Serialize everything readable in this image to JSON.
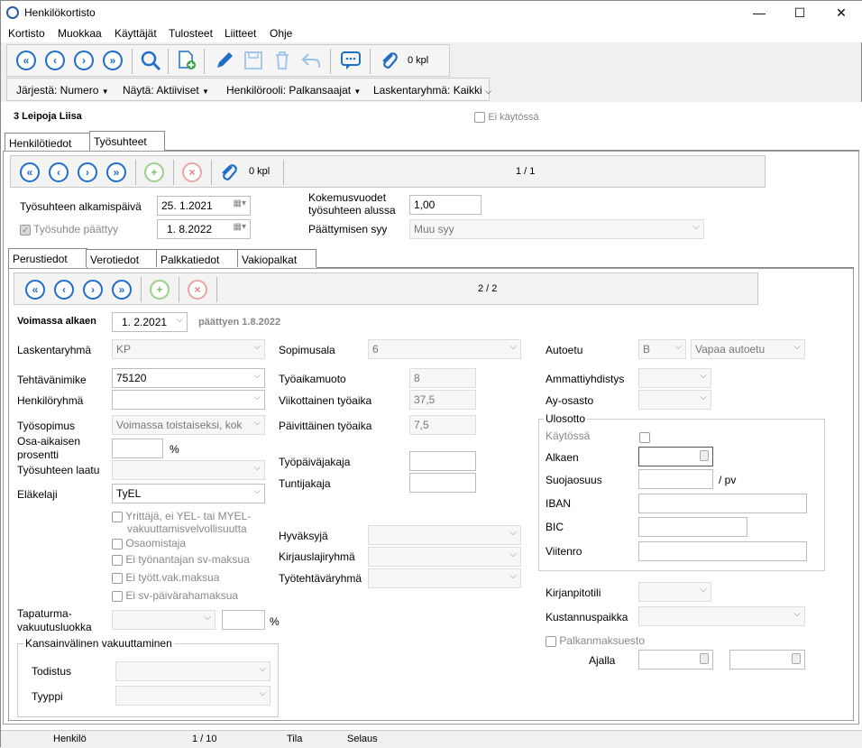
{
  "window": {
    "title": "Henkilökortisto",
    "minimize": "—",
    "maximize": "☐",
    "close": "✕"
  },
  "menu": [
    "Kortisto",
    "Muokkaa",
    "Käyttäjät",
    "Tulosteet",
    "Liitteet",
    "Ohje"
  ],
  "toolbar": {
    "attachments_count": "0 kpl"
  },
  "filters": {
    "sort": "Järjestä: Numero",
    "show": "Näytä: Aktiiviset",
    "role": "Henkilörooli: Palkansaajat",
    "group": "Laskentaryhmä: Kaikki"
  },
  "person": {
    "header": "3  Leipoja Liisa",
    "inactive_label": "Ei käytössä"
  },
  "outer_tabs": [
    "Henkilötiedot",
    "Työsuhteet"
  ],
  "employment_nav": {
    "attachments": "0 kpl",
    "page": "1 / 1"
  },
  "employment": {
    "start_label": "Työsuhteen alkamispäivä",
    "start_value": "25.  1.2021",
    "ended_label": "Työsuhde päättyy",
    "ended_value": "1.  8.2022",
    "experience_label_1": "Kokemusvuodet",
    "experience_label_2": "työsuhteen alussa",
    "experience_value": "1,00",
    "reason_label": "Päättymisen syy",
    "reason_value": "Muu syy"
  },
  "inner_tabs": [
    "Perustiedot",
    "Verotiedot",
    "Palkkatiedot",
    "Vakiopalkat"
  ],
  "basic_nav": {
    "page": "2 / 2"
  },
  "basic": {
    "valid_from_label": "Voimassa alkaen",
    "valid_from_value": "1.  2.2021",
    "ending_text": "päättyen  1.8.2022",
    "calc_group_label": "Laskentaryhmä",
    "calc_group_value": "KP",
    "job_title_label": "Tehtävänimike",
    "job_title_value": "75120",
    "person_group_label": "Henkilöryhmä",
    "contract_label": "Työsopimus",
    "contract_value": "Voimassa toistaiseksi, kok",
    "parttime_label_1": "Osa-aikaisen",
    "parttime_label_2": "prosentti",
    "percent": "%",
    "quality_label": "Työsuhteen laatu",
    "pension_label": "Eläkelaji",
    "pension_value": "TyEL",
    "chk_entrepreneur_1": "Yrittäjä, ei YEL- tai MYEL-",
    "chk_entrepreneur_2": "vakuuttamisvelvollisuutta",
    "chk_partowner": "Osaomistaja",
    "chk_no_employer_sv": "Ei työnantajan sv-maksua",
    "chk_no_unemp": "Ei tyött.vak.maksua",
    "chk_no_sv_daily": "Ei sv-päivärahamaksua",
    "accident_label_1": "Tapaturma-",
    "accident_label_2": "vakuutusluokka",
    "intl_group": "Kansainvälinen vakuuttaminen",
    "certificate_label": "Todistus",
    "type_label": "Tyyppi",
    "agreement_label": "Sopimusala",
    "agreement_value": "6",
    "worktime_form_label": "Työaikamuoto",
    "worktime_form_value": "8",
    "weekly_label": "Viikottainen työaika",
    "weekly_value": "37,5",
    "daily_label": "Päivittäinen työaika",
    "daily_value": "7,5",
    "workday_divisor_label": "Työpäiväjakaja",
    "hour_divisor_label": "Tuntijakaja",
    "approver_label": "Hyväksyjä",
    "entry_type_label": "Kirjauslajiryhmä",
    "task_group_label": "Työtehtäväryhmä",
    "car_benefit_label": "Autoetu",
    "car_benefit_code": "B",
    "car_benefit_value": "Vapaa autoetu",
    "union_label": "Ammattiyhdistys",
    "union_dept_label": "Ay-osasto",
    "garnish_group": "Ulosotto",
    "in_use_label": "Käytössä",
    "from_label": "Alkaen",
    "protected_label": "Suojaosuus",
    "per_day": "/ pv",
    "iban_label": "IBAN",
    "bic_label": "BIC",
    "ref_label": "Viitenro",
    "accounting_label": "Kirjanpitotili",
    "cost_center_label": "Kustannuspaikka",
    "pay_hold_label": "Palkanmaksuesto",
    "period_label": "Ajalla"
  },
  "status": {
    "entity": "Henkilö",
    "record": "1 / 10",
    "state_label": "Tila",
    "state_value": "Selaus"
  }
}
